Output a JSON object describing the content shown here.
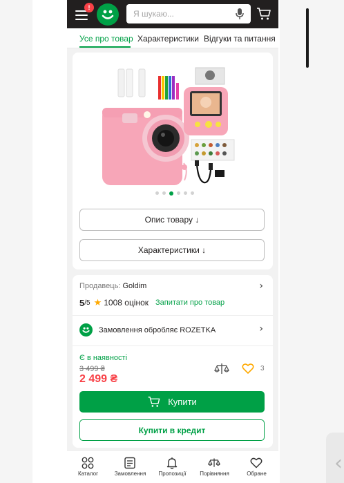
{
  "header": {
    "notification_count": "!",
    "search_placeholder": "Я шукаю..."
  },
  "tabs": [
    {
      "label": "Усе про товар",
      "active": true
    },
    {
      "label": "Характеристики",
      "active": false
    },
    {
      "label": "Відгуки та питання",
      "active": false
    }
  ],
  "gallery": {
    "image_description_icon": "pink-kids-instant-camera",
    "slides_total": 6,
    "active_slide": 3
  },
  "buttons": {
    "description": "Опис товару ↓",
    "characteristics": "Характеристики ↓",
    "buy": "Купити",
    "credit": "Купити в кредит"
  },
  "seller": {
    "label": "Продавець:",
    "name": "Goldim"
  },
  "rating": {
    "score": "5",
    "of": "/5",
    "reviews": "1008 оцінок",
    "ask": "Запитати про товар"
  },
  "order_processor": "Замовлення обробляє ROZETKA",
  "availability": "Є в наявності",
  "old_price": "3 499 ₴",
  "price": "2 499 ₴",
  "favorites_count": "3",
  "colors": {
    "brand_green": "#00a046",
    "price_red": "#f84147",
    "header_dark": "#221f1f"
  },
  "bottom_nav": [
    {
      "label": "Каталог",
      "icon": "catalog-icon"
    },
    {
      "label": "Замовлення",
      "icon": "orders-icon"
    },
    {
      "label": "Пропозиції",
      "icon": "bell-icon"
    },
    {
      "label": "Порівняння",
      "icon": "compare-icon"
    },
    {
      "label": "Обране",
      "icon": "heart-icon"
    }
  ]
}
